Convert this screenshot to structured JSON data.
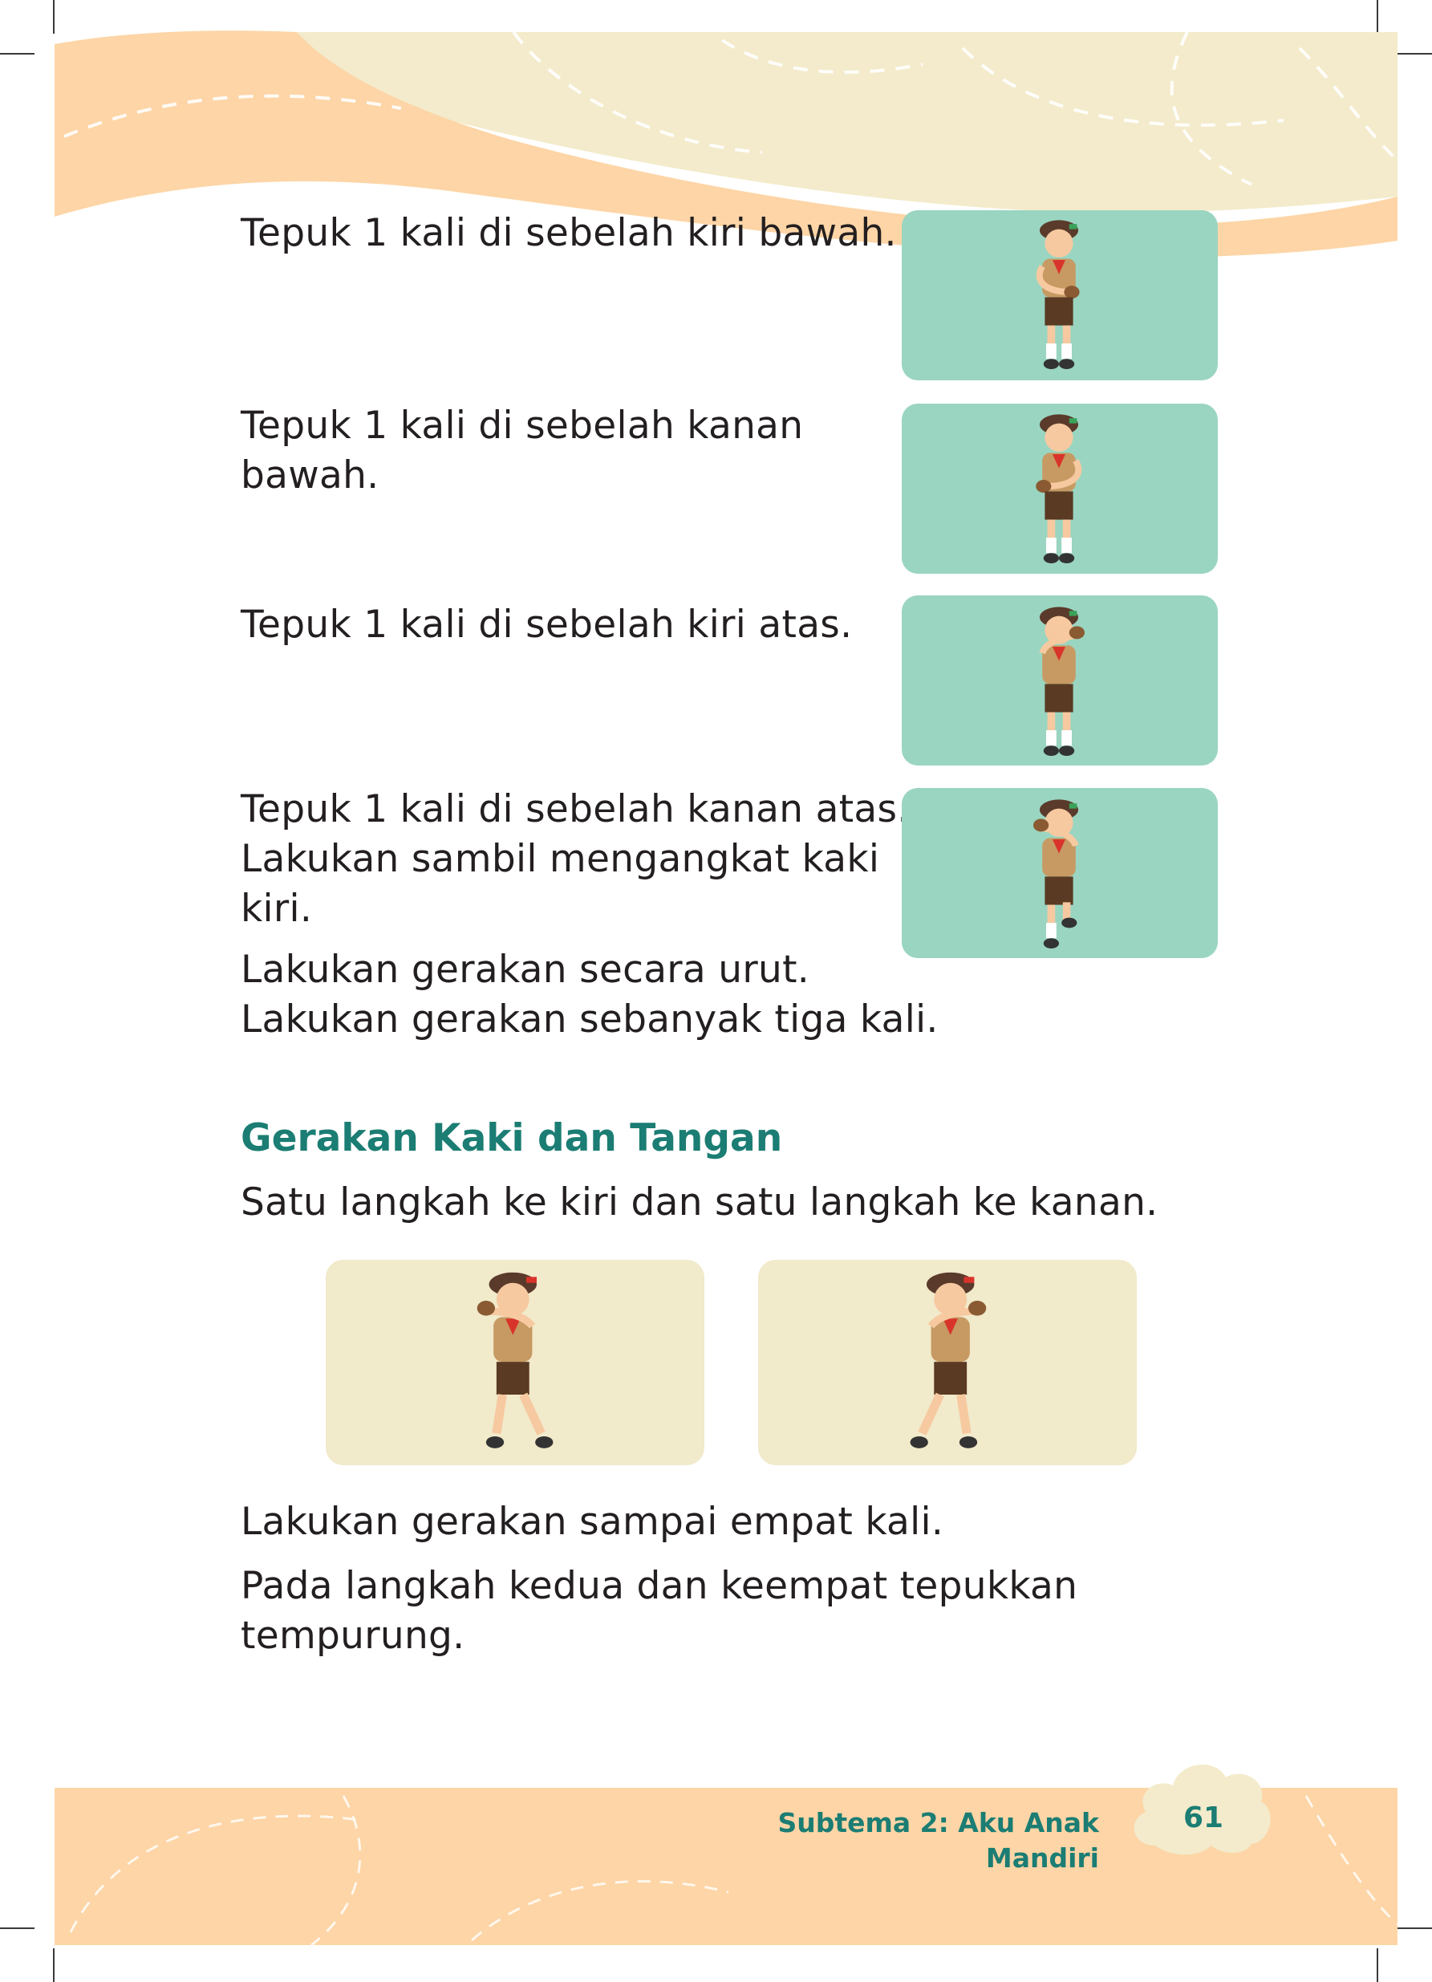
{
  "colors": {
    "header_light": "#f3ebcb",
    "header_peach": "#fdd5a6",
    "panel_green": "#9ad5c1",
    "panel_cream": "#f1eacb",
    "heading_teal": "#1b7d73",
    "footer_peach": "#fdd5a6"
  },
  "steps": [
    {
      "lines": [
        "Tepuk 1 kali di sebelah kiri bawah."
      ],
      "illustration": "scout-clap-lower-left"
    },
    {
      "lines": [
        "Tepuk 1 kali di sebelah kanan",
        "bawah."
      ],
      "illustration": "scout-clap-lower-right"
    },
    {
      "lines": [
        "Tepuk 1 kali di sebelah kiri atas."
      ],
      "illustration": "scout-clap-upper-left"
    },
    {
      "lines": [
        "Tepuk 1 kali di sebelah kanan atas.",
        "Lakukan sambil mengangkat kaki",
        "kiri."
      ],
      "illustration": "scout-clap-upper-right-raised-leg"
    }
  ],
  "instructions": [
    "Lakukan gerakan secara urut.",
    "Lakukan gerakan sebanyak tiga kali."
  ],
  "section": {
    "heading": "Gerakan Kaki dan Tangan",
    "intro": "Satu langkah ke kiri dan satu langkah ke kanan.",
    "illustrations": [
      "scout-step-left",
      "scout-step-right"
    ],
    "closing": [
      "Lakukan gerakan sampai empat kali.",
      "Pada langkah kedua dan keempat tepukkan",
      "tempurung."
    ]
  },
  "footer": {
    "subtheme": "Subtema 2: Aku Anak Mandiri",
    "page_number": "61"
  }
}
